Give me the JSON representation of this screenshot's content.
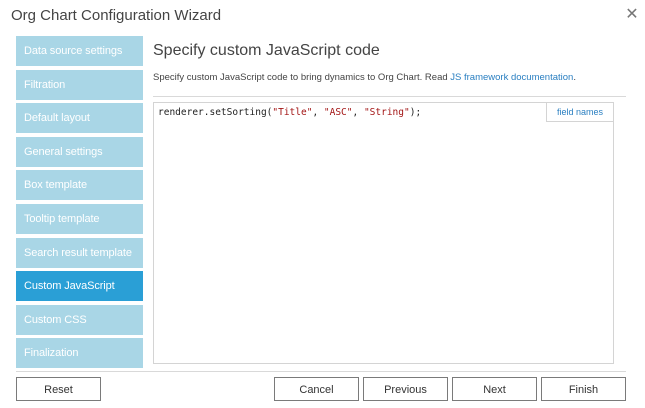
{
  "window": {
    "title": "Org Chart Configuration Wizard"
  },
  "sidebar": {
    "items": [
      {
        "label": "Data source settings",
        "active": false
      },
      {
        "label": "Filtration",
        "active": false
      },
      {
        "label": "Default layout",
        "active": false
      },
      {
        "label": "General settings",
        "active": false
      },
      {
        "label": "Box template",
        "active": false
      },
      {
        "label": "Tooltip template",
        "active": false
      },
      {
        "label": "Search result template",
        "active": false
      },
      {
        "label": "Custom JavaScript",
        "active": true
      },
      {
        "label": "Custom CSS",
        "active": false
      },
      {
        "label": "Finalization",
        "active": false
      }
    ]
  },
  "main": {
    "heading": "Specify custom JavaScript code",
    "description": "Specify custom JavaScript code to bring dynamics to Org Chart. Read ",
    "doc_link": "JS framework documentation",
    "description_end": ".",
    "editor": {
      "code_prefix": "renderer.setSorting(",
      "arg1": "\"Title\"",
      "sep1": ", ",
      "arg2": "\"ASC\"",
      "sep2": ", ",
      "arg3": "\"String\"",
      "code_suffix": ");",
      "field_names_label": "field names"
    }
  },
  "footer": {
    "reset": "Reset",
    "cancel": "Cancel",
    "previous": "Previous",
    "next": "Next",
    "finish": "Finish"
  },
  "colors": {
    "nav_inactive": "#a9d6e6",
    "nav_active": "#2a9fd6",
    "link": "#2a7fc1"
  }
}
